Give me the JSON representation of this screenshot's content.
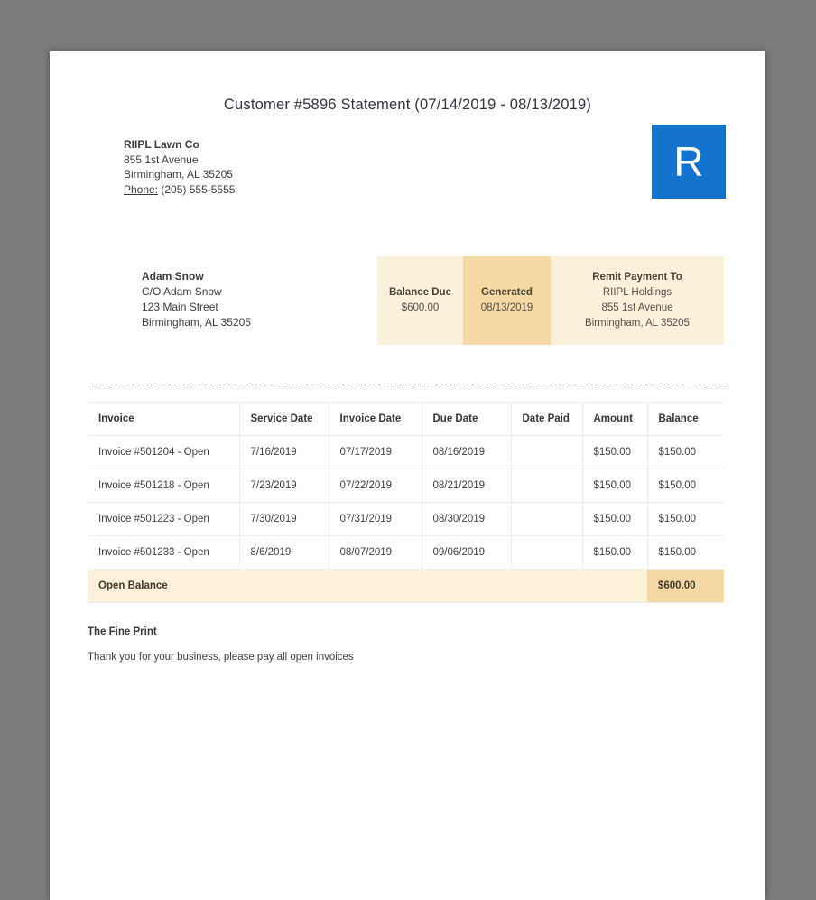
{
  "statement": {
    "title": "Customer #5896 Statement (07/14/2019 - 08/13/2019)"
  },
  "company": {
    "name": "RIIPL Lawn Co",
    "address_line1": "855 1st Avenue",
    "address_line2": "Birmingham, AL 35205",
    "phone_label": "Phone:",
    "phone_number": "(205) 555-5555",
    "logo_letter": "R"
  },
  "recipient": {
    "name": "Adam Snow",
    "care_of": "C/O Adam Snow",
    "address_line1": "123 Main Street",
    "address_line2": "Birmingham, AL 35205"
  },
  "summary": {
    "balance_due": {
      "label": "Balance Due",
      "value": "$600.00"
    },
    "generated": {
      "label": "Generated",
      "value": "08/13/2019"
    },
    "remit": {
      "label": "Remit Payment To",
      "name": "RIIPL Holdings",
      "address_line1": "855 1st Avenue",
      "address_line2": "Birmingham, AL 35205"
    }
  },
  "invoices": {
    "headers": [
      "Invoice",
      "Service Date",
      "Invoice Date",
      "Due Date",
      "Date Paid",
      "Amount",
      "Balance"
    ],
    "rows": [
      [
        "Invoice #501204 - Open",
        "7/16/2019",
        "07/17/2019",
        "08/16/2019",
        "",
        "$150.00",
        "$150.00"
      ],
      [
        "Invoice #501218 - Open",
        "7/23/2019",
        "07/22/2019",
        "08/21/2019",
        "",
        "$150.00",
        "$150.00"
      ],
      [
        "Invoice #501223 - Open",
        "7/30/2019",
        "07/31/2019",
        "08/30/2019",
        "",
        "$150.00",
        "$150.00"
      ],
      [
        "Invoice #501233 - Open",
        "8/6/2019",
        "08/07/2019",
        "09/06/2019",
        "",
        "$150.00",
        "$150.00"
      ]
    ],
    "footer": {
      "label": "Open Balance",
      "value": "$600.00"
    }
  },
  "fine_print": {
    "heading": "The Fine Print",
    "body": "Thank you for your business, please pay all open invoices"
  },
  "colors": {
    "accent_blue": "#1473cc",
    "cream_light": "#fbf0da",
    "cream_dark": "#f6d9a2",
    "backdrop_gray": "#7c7c7c"
  }
}
